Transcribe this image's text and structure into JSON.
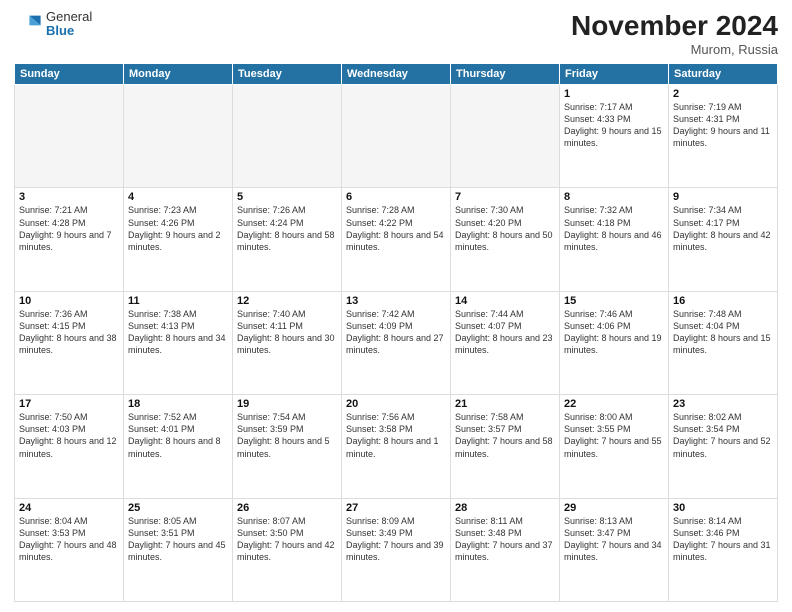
{
  "logo": {
    "general": "General",
    "blue": "Blue"
  },
  "header": {
    "month": "November 2024",
    "location": "Murom, Russia"
  },
  "weekdays": [
    "Sunday",
    "Monday",
    "Tuesday",
    "Wednesday",
    "Thursday",
    "Friday",
    "Saturday"
  ],
  "rows": [
    [
      {
        "day": "",
        "empty": true
      },
      {
        "day": "",
        "empty": true
      },
      {
        "day": "",
        "empty": true
      },
      {
        "day": "",
        "empty": true
      },
      {
        "day": "",
        "empty": true
      },
      {
        "day": "1",
        "sunrise": "7:17 AM",
        "sunset": "4:33 PM",
        "daylight": "9 hours and 15 minutes."
      },
      {
        "day": "2",
        "sunrise": "7:19 AM",
        "sunset": "4:31 PM",
        "daylight": "9 hours and 11 minutes."
      }
    ],
    [
      {
        "day": "3",
        "sunrise": "7:21 AM",
        "sunset": "4:28 PM",
        "daylight": "9 hours and 7 minutes."
      },
      {
        "day": "4",
        "sunrise": "7:23 AM",
        "sunset": "4:26 PM",
        "daylight": "9 hours and 2 minutes."
      },
      {
        "day": "5",
        "sunrise": "7:26 AM",
        "sunset": "4:24 PM",
        "daylight": "8 hours and 58 minutes."
      },
      {
        "day": "6",
        "sunrise": "7:28 AM",
        "sunset": "4:22 PM",
        "daylight": "8 hours and 54 minutes."
      },
      {
        "day": "7",
        "sunrise": "7:30 AM",
        "sunset": "4:20 PM",
        "daylight": "8 hours and 50 minutes."
      },
      {
        "day": "8",
        "sunrise": "7:32 AM",
        "sunset": "4:18 PM",
        "daylight": "8 hours and 46 minutes."
      },
      {
        "day": "9",
        "sunrise": "7:34 AM",
        "sunset": "4:17 PM",
        "daylight": "8 hours and 42 minutes."
      }
    ],
    [
      {
        "day": "10",
        "sunrise": "7:36 AM",
        "sunset": "4:15 PM",
        "daylight": "8 hours and 38 minutes."
      },
      {
        "day": "11",
        "sunrise": "7:38 AM",
        "sunset": "4:13 PM",
        "daylight": "8 hours and 34 minutes."
      },
      {
        "day": "12",
        "sunrise": "7:40 AM",
        "sunset": "4:11 PM",
        "daylight": "8 hours and 30 minutes."
      },
      {
        "day": "13",
        "sunrise": "7:42 AM",
        "sunset": "4:09 PM",
        "daylight": "8 hours and 27 minutes."
      },
      {
        "day": "14",
        "sunrise": "7:44 AM",
        "sunset": "4:07 PM",
        "daylight": "8 hours and 23 minutes."
      },
      {
        "day": "15",
        "sunrise": "7:46 AM",
        "sunset": "4:06 PM",
        "daylight": "8 hours and 19 minutes."
      },
      {
        "day": "16",
        "sunrise": "7:48 AM",
        "sunset": "4:04 PM",
        "daylight": "8 hours and 15 minutes."
      }
    ],
    [
      {
        "day": "17",
        "sunrise": "7:50 AM",
        "sunset": "4:03 PM",
        "daylight": "8 hours and 12 minutes."
      },
      {
        "day": "18",
        "sunrise": "7:52 AM",
        "sunset": "4:01 PM",
        "daylight": "8 hours and 8 minutes."
      },
      {
        "day": "19",
        "sunrise": "7:54 AM",
        "sunset": "3:59 PM",
        "daylight": "8 hours and 5 minutes."
      },
      {
        "day": "20",
        "sunrise": "7:56 AM",
        "sunset": "3:58 PM",
        "daylight": "8 hours and 1 minute."
      },
      {
        "day": "21",
        "sunrise": "7:58 AM",
        "sunset": "3:57 PM",
        "daylight": "7 hours and 58 minutes."
      },
      {
        "day": "22",
        "sunrise": "8:00 AM",
        "sunset": "3:55 PM",
        "daylight": "7 hours and 55 minutes."
      },
      {
        "day": "23",
        "sunrise": "8:02 AM",
        "sunset": "3:54 PM",
        "daylight": "7 hours and 52 minutes."
      }
    ],
    [
      {
        "day": "24",
        "sunrise": "8:04 AM",
        "sunset": "3:53 PM",
        "daylight": "7 hours and 48 minutes."
      },
      {
        "day": "25",
        "sunrise": "8:05 AM",
        "sunset": "3:51 PM",
        "daylight": "7 hours and 45 minutes."
      },
      {
        "day": "26",
        "sunrise": "8:07 AM",
        "sunset": "3:50 PM",
        "daylight": "7 hours and 42 minutes."
      },
      {
        "day": "27",
        "sunrise": "8:09 AM",
        "sunset": "3:49 PM",
        "daylight": "7 hours and 39 minutes."
      },
      {
        "day": "28",
        "sunrise": "8:11 AM",
        "sunset": "3:48 PM",
        "daylight": "7 hours and 37 minutes."
      },
      {
        "day": "29",
        "sunrise": "8:13 AM",
        "sunset": "3:47 PM",
        "daylight": "7 hours and 34 minutes."
      },
      {
        "day": "30",
        "sunrise": "8:14 AM",
        "sunset": "3:46 PM",
        "daylight": "7 hours and 31 minutes."
      }
    ]
  ]
}
